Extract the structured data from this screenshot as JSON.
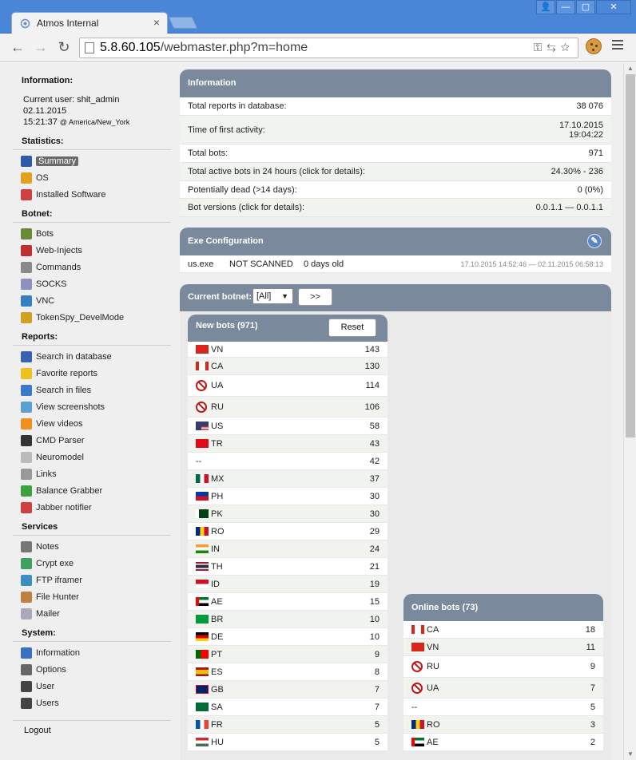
{
  "browser": {
    "tab_title": "Atmos Internal",
    "tab_close": "×",
    "url_host": "5.8.60.105",
    "url_path": "/webmaster.php?m=home",
    "window_buttons": [
      "👤",
      "—",
      "▢",
      "✕"
    ]
  },
  "sidebar": {
    "information_title": "Information:",
    "current_user": "Current user: shit_admin",
    "date": "02.11.2015",
    "time": "15:21:37",
    "timezone": "@ America/New_York",
    "statistics_title": "Statistics:",
    "statistics_items": [
      {
        "label": "Summary",
        "icon": "home-icon",
        "active": true
      },
      {
        "label": "OS",
        "icon": "windows-icon"
      },
      {
        "label": "Installed Software",
        "icon": "software-icon"
      }
    ],
    "botnet_title": "Botnet:",
    "botnet_items": [
      {
        "label": "Bots",
        "icon": "bots-icon"
      },
      {
        "label": "Web-Injects",
        "icon": "injects-icon"
      },
      {
        "label": "Commands",
        "icon": "commands-icon"
      },
      {
        "label": "SOCKS",
        "icon": "socks-icon"
      },
      {
        "label": "VNC",
        "icon": "vnc-icon"
      },
      {
        "label": "TokenSpy_DevelMode",
        "icon": "key-icon"
      }
    ],
    "reports_title": "Reports:",
    "reports_items": [
      {
        "label": "Search in database",
        "icon": "database-icon"
      },
      {
        "label": "Favorite reports",
        "icon": "star-icon"
      },
      {
        "label": "Search in files",
        "icon": "folder-icon"
      },
      {
        "label": "View screenshots",
        "icon": "screenshot-icon"
      },
      {
        "label": "View videos",
        "icon": "video-icon"
      },
      {
        "label": "CMD Parser",
        "icon": "cmd-icon"
      },
      {
        "label": "Neuromodel",
        "icon": "neuro-icon"
      },
      {
        "label": "Links",
        "icon": "search-icon"
      },
      {
        "label": "Balance Grabber",
        "icon": "dollar-icon"
      },
      {
        "label": "Jabber notifier",
        "icon": "jabber-icon"
      }
    ],
    "services_title": "Services",
    "services_items": [
      {
        "label": "Notes",
        "icon": "pen-icon"
      },
      {
        "label": "Crypt exe",
        "icon": "shield-icon"
      },
      {
        "label": "FTP iframer",
        "icon": "globe-icon"
      },
      {
        "label": "File Hunter",
        "icon": "file-hunter-icon"
      },
      {
        "label": "Mailer",
        "icon": "mail-icon"
      }
    ],
    "system_title": "System:",
    "system_items": [
      {
        "label": "Information",
        "icon": "info-icon"
      },
      {
        "label": "Options",
        "icon": "gear-icon"
      },
      {
        "label": "User",
        "icon": "user-icon"
      },
      {
        "label": "Users",
        "icon": "users-icon"
      }
    ],
    "logout": "Logout"
  },
  "information": {
    "title": "Information",
    "rows": [
      {
        "label": "Total reports in database:",
        "value": "38 076"
      },
      {
        "label": "Time of first activity:",
        "value": "17.10.2015",
        "value2": "19:04:22"
      },
      {
        "label": "Total bots:",
        "value": "971"
      },
      {
        "label": "Total active bots in 24 hours (click for details):",
        "value": "24.30% - 236"
      },
      {
        "label": "Potentially dead (>14 days):",
        "value": "0 (0%)"
      },
      {
        "label": "Bot versions (click for details):",
        "value": "0.0.1.1 — 0.0.1.1"
      }
    ]
  },
  "exe_config": {
    "title": "Exe Configuration",
    "file": "us.exe",
    "status": "NOT SCANNED",
    "age": "0 days old",
    "range": "17.10.2015 14:52:46 — 02.11.2015 06:58:13"
  },
  "botnet": {
    "label": "Current botnet:",
    "selected": "[All]",
    "go_label": ">>"
  },
  "new_bots": {
    "title": "New bots (971)",
    "reset_label": "Reset",
    "rows": [
      {
        "code": "VN",
        "count": "143",
        "flag": "vn"
      },
      {
        "code": "CA",
        "count": "130",
        "flag": "ca"
      },
      {
        "code": "UA",
        "count": "114",
        "flag": "ban"
      },
      {
        "code": "RU",
        "count": "106",
        "flag": "ban"
      },
      {
        "code": "US",
        "count": "58",
        "flag": "us"
      },
      {
        "code": "TR",
        "count": "43",
        "flag": "tr"
      },
      {
        "code": "--",
        "count": "42",
        "flag": "none"
      },
      {
        "code": "MX",
        "count": "37",
        "flag": "mx"
      },
      {
        "code": "PH",
        "count": "30",
        "flag": "ph"
      },
      {
        "code": "PK",
        "count": "30",
        "flag": "pk"
      },
      {
        "code": "RO",
        "count": "29",
        "flag": "ro"
      },
      {
        "code": "IN",
        "count": "24",
        "flag": "in"
      },
      {
        "code": "TH",
        "count": "21",
        "flag": "th"
      },
      {
        "code": "ID",
        "count": "19",
        "flag": "id"
      },
      {
        "code": "AE",
        "count": "15",
        "flag": "ae"
      },
      {
        "code": "BR",
        "count": "10",
        "flag": "br"
      },
      {
        "code": "DE",
        "count": "10",
        "flag": "de"
      },
      {
        "code": "PT",
        "count": "9",
        "flag": "pt"
      },
      {
        "code": "ES",
        "count": "8",
        "flag": "es"
      },
      {
        "code": "GB",
        "count": "7",
        "flag": "gb"
      },
      {
        "code": "SA",
        "count": "7",
        "flag": "sa"
      },
      {
        "code": "FR",
        "count": "5",
        "flag": "fr"
      },
      {
        "code": "HU",
        "count": "5",
        "flag": "hu"
      }
    ]
  },
  "online_bots": {
    "title": "Online bots (73)",
    "rows": [
      {
        "code": "CA",
        "count": "18",
        "flag": "ca"
      },
      {
        "code": "VN",
        "count": "11",
        "flag": "vn"
      },
      {
        "code": "RU",
        "count": "9",
        "flag": "ban"
      },
      {
        "code": "UA",
        "count": "7",
        "flag": "ban"
      },
      {
        "code": "--",
        "count": "5",
        "flag": "none"
      },
      {
        "code": "RO",
        "count": "3",
        "flag": "ro"
      },
      {
        "code": "AE",
        "count": "2",
        "flag": "ae"
      }
    ]
  }
}
